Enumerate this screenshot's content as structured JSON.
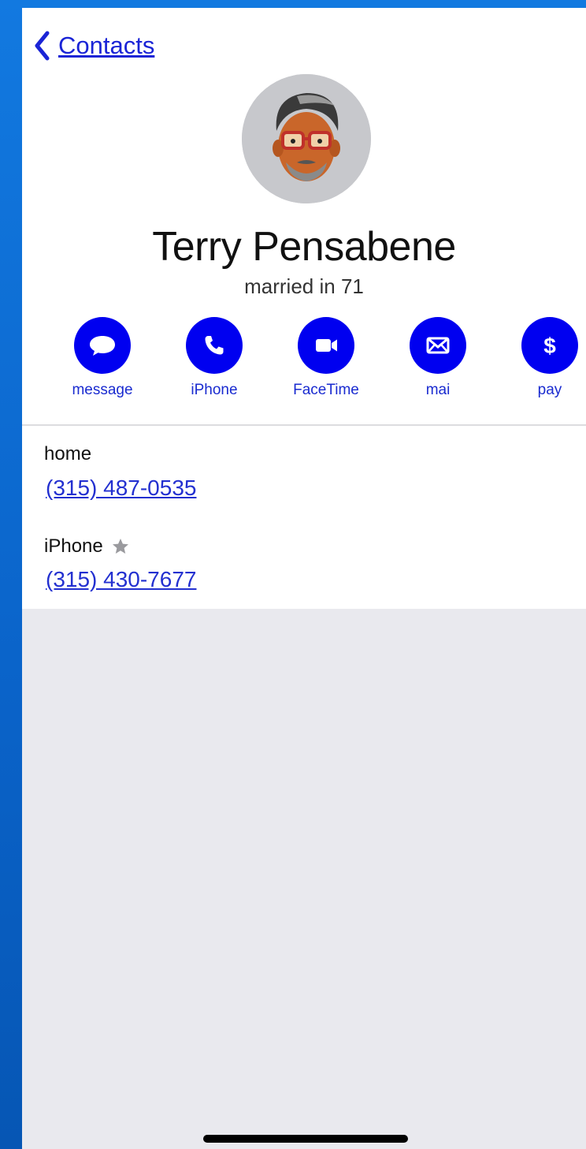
{
  "nav": {
    "back_label": "Contacts"
  },
  "contact": {
    "name": "Terry Pensabene",
    "subtitle": "married in 71"
  },
  "actions": [
    {
      "label": "message",
      "icon": "message-bubble-icon"
    },
    {
      "label": "iPhone",
      "icon": "phone-icon"
    },
    {
      "label": "FaceTime",
      "icon": "video-camera-icon"
    },
    {
      "label": "mai",
      "icon": "mail-envelope-icon"
    },
    {
      "label": "pay",
      "icon": "dollar-icon"
    }
  ],
  "phones": [
    {
      "label": "home",
      "value": "(315) 487-0535",
      "favorite": false
    },
    {
      "label": "iPhone",
      "value": "(315) 430-7677",
      "favorite": true
    }
  ],
  "colors": {
    "accent": "#0000f0",
    "link": "#2330d0",
    "background": "#e9e9ee"
  }
}
